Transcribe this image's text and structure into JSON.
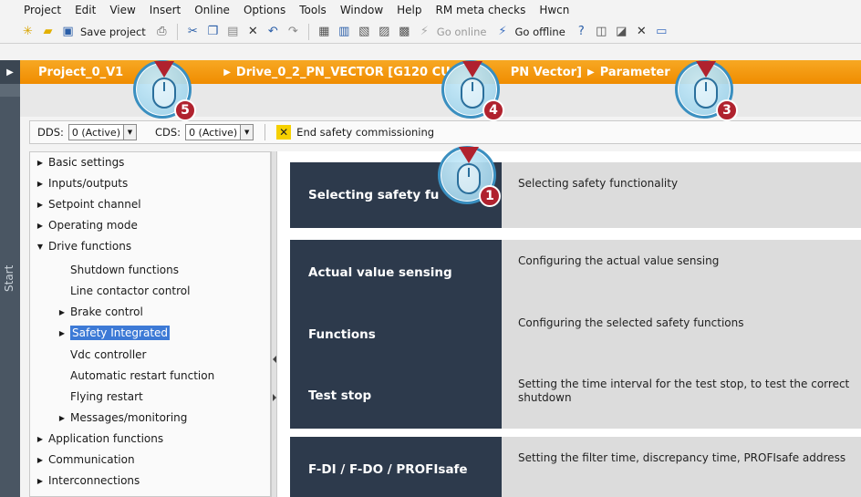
{
  "menu": [
    "Project",
    "Edit",
    "View",
    "Insert",
    "Online",
    "Options",
    "Tools",
    "Window",
    "Help",
    "RM meta checks",
    "Hwcn"
  ],
  "toolbar": {
    "save_label": "Save project",
    "go_online_label": "Go online",
    "go_offline_label": "Go offline"
  },
  "breadcrumb": {
    "project": "Project_0_V1",
    "drive": "Drive_0_2_PN_VECTOR [G120 CU",
    "drive_tail": "PN Vector]",
    "section": "Parameter"
  },
  "start_tab": "Start",
  "dds": {
    "label": "DDS:",
    "value": "0 (Active)"
  },
  "cds": {
    "label": "CDS:",
    "value": "0 (Active)"
  },
  "end_safety_label": "End safety commissioning",
  "tree": [
    {
      "label": "Basic settings",
      "tri": "▶"
    },
    {
      "label": "Inputs/outputs",
      "tri": "▶"
    },
    {
      "label": "Setpoint channel",
      "tri": "▶"
    },
    {
      "label": "Operating mode",
      "tri": "▶"
    },
    {
      "label": "Drive functions",
      "tri": "▼"
    },
    {
      "label": "Shutdown functions",
      "tri": ""
    },
    {
      "label": "Line contactor control",
      "tri": ""
    },
    {
      "label": "Brake control",
      "tri": "▶"
    },
    {
      "label": "Safety Integrated",
      "tri": "▶"
    },
    {
      "label": "Vdc controller",
      "tri": ""
    },
    {
      "label": "Automatic restart function",
      "tri": ""
    },
    {
      "label": "Flying restart",
      "tri": ""
    },
    {
      "label": "Messages/monitoring",
      "tri": "▶"
    },
    {
      "label": "Application functions",
      "tri": "▶"
    },
    {
      "label": "Communication",
      "tri": "▶"
    },
    {
      "label": "Interconnections",
      "tri": "▶"
    }
  ],
  "rows": [
    {
      "button": "Selecting safety fu",
      "desc": "Selecting safety functionality"
    },
    {
      "button": "Actual value sensing",
      "desc": "Configuring the actual value sensing"
    },
    {
      "button": "Functions",
      "desc": "Configuring the selected safety functions"
    },
    {
      "button": "Test stop",
      "desc": "Setting the time interval for the test stop, to test the correct shutdown"
    },
    {
      "button": "F-DI / F-DO / PROFIsafe",
      "desc": "Setting the filter time, discrepancy time, PROFIsafe address"
    }
  ],
  "callouts": [
    "5",
    "4",
    "3",
    "1"
  ],
  "colors": {
    "breadcrumb": "#f39a12",
    "button_bg": "#2d3a4c",
    "desc_bg": "#dcdcdc",
    "selection": "#3d7ad6",
    "callout_badge": "#b0222e"
  }
}
